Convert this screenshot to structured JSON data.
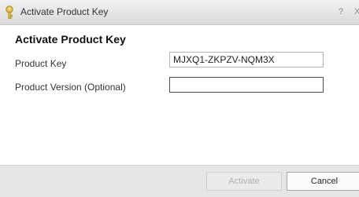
{
  "window": {
    "title": "Activate Product Key",
    "help_label": "?",
    "close_label": "X"
  },
  "form": {
    "heading": "Activate Product Key",
    "product_key_label": "Product Key",
    "product_key_value": "MJXQ1-ZKPZV-NQM3X",
    "product_version_label": "Product Version (Optional)",
    "product_version_value": ""
  },
  "footer": {
    "activate_label": "Activate",
    "cancel_label": "Cancel"
  },
  "colors": {
    "key_icon": "#e8c13c",
    "activate_text": "#b0b0b0"
  },
  "icons": {
    "window_icon": "key-icon"
  }
}
